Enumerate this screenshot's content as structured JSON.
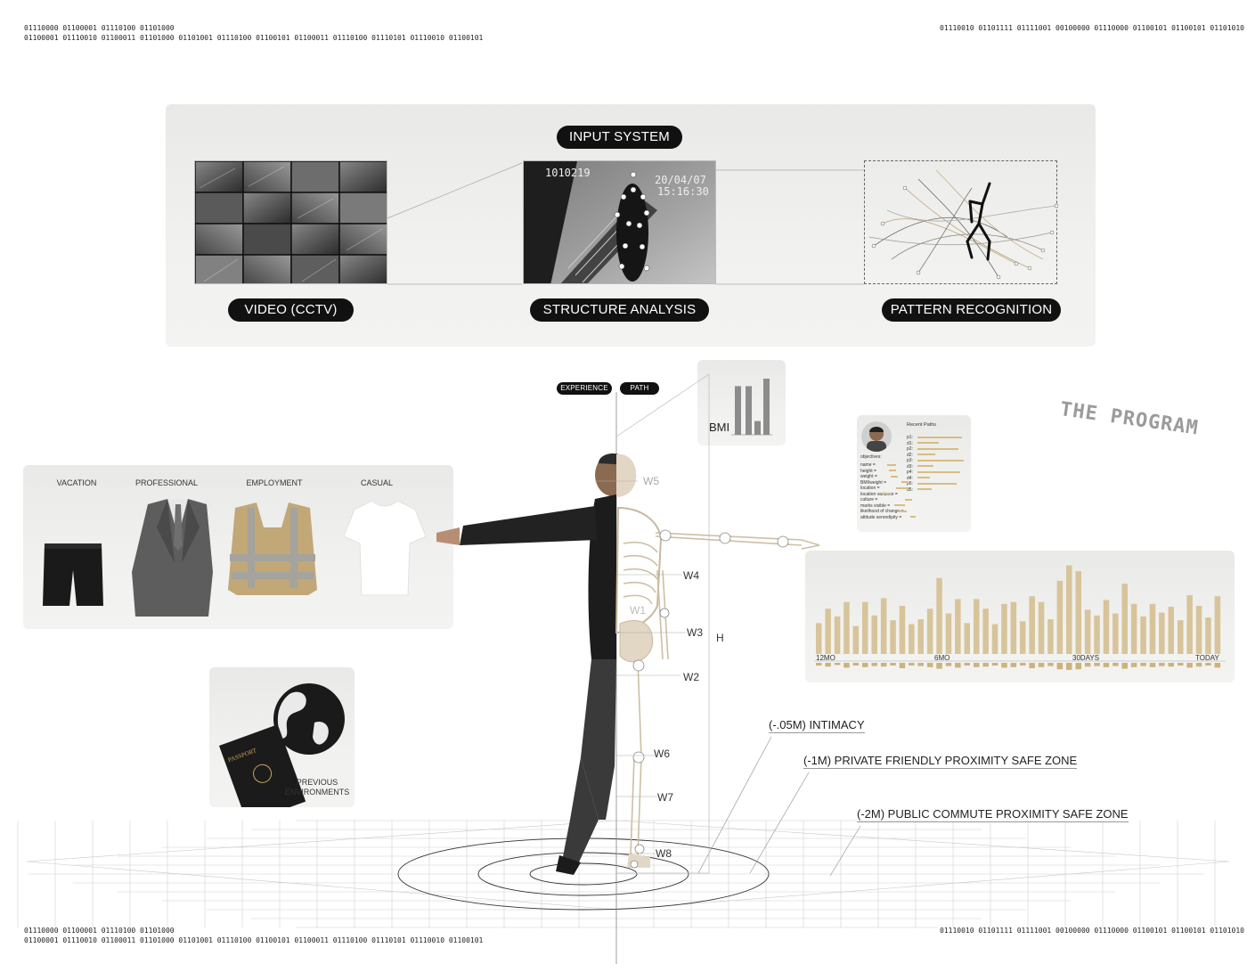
{
  "binary": {
    "top_left_1": "01110000 01100001 01110100 01101000",
    "top_left_2": "01100001 01110010 01100011 01101000 01101001 01110100 01100101 01100011 01110100 01110101 01110010 01100101",
    "top_right": "01110010 01101111 01111001 00100000 01110000 01100101 01100101 01101010",
    "bottom_left_1": "01110000 01100001 01110100 01101000",
    "bottom_left_2": "01100001 01110010 01100011 01101000 01101001 01110100 01100101 01100011 01110100 01110101 01110010 01100101",
    "bottom_right": "01110010 01101111 01111001 00100000 01110000 01100101 01100101 01101010"
  },
  "input_system": {
    "title": "INPUT SYSTEM",
    "stages": [
      "VIDEO (CCTV)",
      "STRUCTURE ANALYSIS",
      "PATTERN RECOGNITION"
    ],
    "cctv_stamp_1": "1010219",
    "cctv_stamp_2": "20/04/07",
    "cctv_stamp_3": "15:16:30"
  },
  "toggle": {
    "left": "EXPERIENCE",
    "right": "PATH"
  },
  "bmi": {
    "label": "BMI",
    "bars": [
      0.78,
      0.78,
      0.22,
      0.9
    ]
  },
  "brand": "THE PROGRAM",
  "clothing": {
    "categories": [
      "VACATION",
      "PROFESSIONAL",
      "EMPLOYMENT",
      "CASUAL"
    ]
  },
  "environments": {
    "label_1": "PREVIOUS",
    "label_2": "ENVIRONMENTS",
    "passport": "PASSPORT"
  },
  "measurements": [
    "W5",
    "W4",
    "W1",
    "W3",
    "H",
    "W2",
    "W6",
    "W7",
    "W8"
  ],
  "zones": [
    "(-.05M) INTIMACY",
    "(-1M) PRIVATE FRIENDLY PROXIMITY SAFE ZONE",
    "(-2M) PUBLIC COMMUTE PROXIMITY SAFE ZONE"
  ],
  "profile": {
    "header": "Recent Paths",
    "subject": "objectives:",
    "fields": [
      "name =",
      "height =",
      "weight =",
      "BMI/weight =",
      "location =",
      "",
      "location variance =",
      "culture =",
      "marks visible =",
      "likelihood of change =",
      "attitude serendipity ="
    ],
    "paths": [
      "p1:",
      "d1:",
      "p2:",
      "d2:",
      "p3:",
      "d3:",
      "p4:",
      "d4:",
      "p5:",
      "d5:"
    ]
  },
  "chart_data": {
    "type": "bar",
    "title": "",
    "axis_labels": [
      "12MO",
      "6MO",
      "30DAYS",
      "TODAY"
    ],
    "values": [
      0.32,
      0.47,
      0.39,
      0.54,
      0.29,
      0.54,
      0.4,
      0.58,
      0.35,
      0.5,
      0.31,
      0.36,
      0.47,
      0.79,
      0.42,
      0.57,
      0.32,
      0.57,
      0.47,
      0.31,
      0.52,
      0.54,
      0.34,
      0.6,
      0.54,
      0.36,
      0.76,
      0.92,
      0.86,
      0.46,
      0.4,
      0.56,
      0.42,
      0.73,
      0.52,
      0.39,
      0.52,
      0.43,
      0.49,
      0.35,
      0.61,
      0.5,
      0.38,
      0.6
    ],
    "neg_values": [
      0.05,
      0.07,
      0.04,
      0.09,
      0.05,
      0.08,
      0.06,
      0.07,
      0.05,
      0.1,
      0.05,
      0.06,
      0.08,
      0.11,
      0.06,
      0.09,
      0.05,
      0.08,
      0.07,
      0.05,
      0.09,
      0.08,
      0.05,
      0.1,
      0.08,
      0.06,
      0.12,
      0.13,
      0.12,
      0.07,
      0.06,
      0.08,
      0.06,
      0.11,
      0.08,
      0.06,
      0.08,
      0.06,
      0.07,
      0.05,
      0.09,
      0.07,
      0.05,
      0.09
    ],
    "colors": {
      "bar": "#d8c49a",
      "neg": "#cdb27a"
    }
  }
}
